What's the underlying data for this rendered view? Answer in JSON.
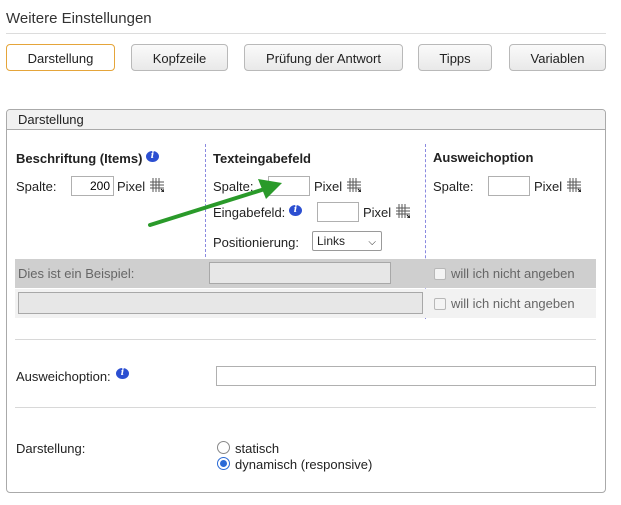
{
  "page_title": "Weitere Einstellungen",
  "tabs": [
    {
      "label": "Darstellung",
      "active": true
    },
    {
      "label": "Kopfzeile",
      "active": false
    },
    {
      "label": "Prüfung der Antwort",
      "active": false
    },
    {
      "label": "Tipps",
      "active": false
    },
    {
      "label": "Variablen",
      "active": false
    }
  ],
  "panel": {
    "title": "Darstellung",
    "columns": {
      "items": {
        "heading": "Beschriftung (Items)",
        "column_label": "Spalte:",
        "column_value": "200",
        "unit": "Pixel"
      },
      "text_field": {
        "heading": "Texteingabefeld",
        "column_label": "Spalte:",
        "column_value": "",
        "unit": "Pixel",
        "input_label": "Eingabefeld:",
        "input_value": "",
        "input_unit": "Pixel",
        "position_label": "Positionierung:",
        "position_value": "Links"
      },
      "fallback": {
        "heading": "Ausweichoption",
        "column_label": "Spalte:",
        "column_value": "",
        "unit": "Pixel"
      }
    },
    "preview": {
      "example_text": "Dies ist ein Beispiel:",
      "fallback_option_1": "will ich nicht angeben",
      "fallback_option_2": "will ich nicht angeben"
    },
    "fallback_row": {
      "label": "Ausweichoption:",
      "value": ""
    },
    "display_row": {
      "label": "Darstellung:",
      "options": [
        {
          "label": "statisch",
          "selected": false
        },
        {
          "label": "dynamisch (responsive)",
          "selected": true
        }
      ]
    }
  },
  "colors": {
    "active_tab_border": "#e5a53a",
    "info_icon": "#2c4fd1",
    "arrow": "#2a9a2a",
    "divider": "#8a8ae0"
  }
}
